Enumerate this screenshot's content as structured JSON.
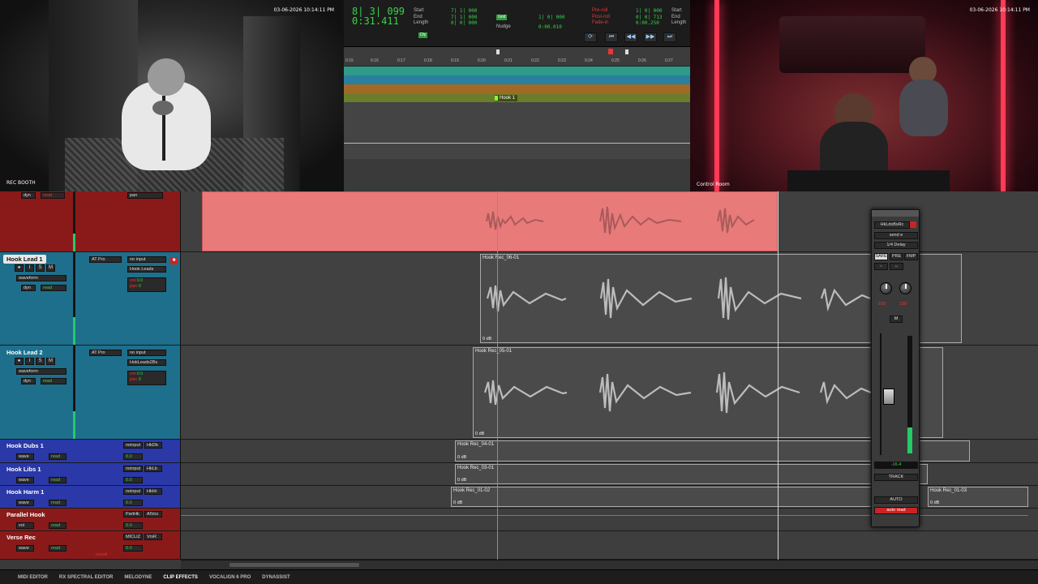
{
  "colors": {
    "accent_green": "#3bd14a",
    "clip_red": "#e87a7a",
    "track_blue": "#1e7c9c",
    "track_purple": "#2a38a8",
    "track_red": "#8a1a1a"
  },
  "cameras": {
    "booth": {
      "timestamp": "03-06-2026 10:14:11 PM",
      "label": "REC BOOTH"
    },
    "control": {
      "timestamp": "03-06-2026 10:14:11 PM",
      "label": "Control Room"
    }
  },
  "transport": {
    "main_counter": "8| 3| 099",
    "sub_counter": "0:31.411",
    "start_label": "Start",
    "end_label": "End",
    "length_label": "Length",
    "start_val": "7| 1| 000",
    "end_val": "7| 1| 000",
    "length_val": "0| 0| 000",
    "grid_label": "Grid",
    "grid_val": "1| 0| 000",
    "nudge_label": "Nudge",
    "nudge_val": "0:00.010",
    "dly_label": "Dly",
    "preroll_label": "Pre-roll",
    "postroll_label": "Post-roll",
    "fadein_label": "Fade-in",
    "preroll_val": "1| 0| 000",
    "postroll_val": "0| 0| 713",
    "fadein_val": "0:00.250",
    "start2_label": "Start",
    "end2_label": "End",
    "length2_label": "Length"
  },
  "ruler": {
    "ticks": [
      "0:15",
      "0:16",
      "0:17",
      "0:18",
      "0:19",
      "0:20",
      "0:21",
      "0:22",
      "0:23",
      "0:24",
      "0:25",
      "0:26",
      "0:27"
    ],
    "marker_label": "Hook 1"
  },
  "tracks": [
    {
      "name": "",
      "pan_label": "pan",
      "dyn_label": "dyn",
      "read_label": "read"
    },
    {
      "name": "Hook Lead 1",
      "insert": "AT Pro",
      "input": "no input",
      "output": "Hook Leads",
      "view": "waveform",
      "dyn": "dyn",
      "read": "read",
      "vol_label": "vol",
      "vol": "0.0",
      "pan_label": "pan",
      "pan": "0"
    },
    {
      "name": "Hook Lead 2",
      "insert": "AT Pro",
      "input": "no input",
      "output": "HokLeads2Bs",
      "view": "waveform",
      "dyn": "dyn",
      "read": "read",
      "vol_label": "vol",
      "vol": "0.0",
      "pan_label": "pan",
      "pan": "0"
    },
    {
      "name": "Hook Dubs 1",
      "io1": "noinput",
      "io2": "HkDb",
      "view": "wave",
      "read": "read",
      "vol": "0.0",
      "p1": "P",
      "p2": "P"
    },
    {
      "name": "Hook Libs 1",
      "io1": "noinput",
      "io2": "HkLb",
      "view": "wave",
      "read": "read",
      "vol": "0.0",
      "p1": "P",
      "p2": "P"
    },
    {
      "name": "Hook Harm 1",
      "io1": "noinput",
      "io2": "HkHr",
      "view": "wave",
      "read": "read",
      "vol": "0.0",
      "p1": "P",
      "p2": "P"
    },
    {
      "name": "Parallel Hook",
      "io1": "PartHk",
      "io2": "AlVox",
      "view": "vol",
      "read": "read",
      "vol": "0.0",
      "p1": "P",
      "p2": "P"
    },
    {
      "name": "Verse Rec",
      "io1": "MICLIZ",
      "io2": "VrsR",
      "view": "wave",
      "read": "read",
      "vol": "0.0",
      "p1": "P",
      "p2": "P"
    }
  ],
  "clips": [
    {
      "name": "Hook Rec_06-01",
      "gain": "0 dB"
    },
    {
      "name": "Hook Rec_05-01",
      "gain": "0 dB"
    },
    {
      "name": "Hook Rec_04-01",
      "gain": "0 dB"
    },
    {
      "name": "Hook Rec_03-01",
      "gain": "0 dB"
    },
    {
      "name": "Hook Rec_01-02",
      "gain": "0 dB"
    },
    {
      "name": "Hook Rec_01-03",
      "gain": "0 dB"
    }
  ],
  "send_window": {
    "title": "HkLdsBsRc",
    "send": "send e",
    "insert": "1/4 Delay",
    "safe": "SAFE",
    "pre": "PRE",
    "fmp": "FMP",
    "pan_l": "-100",
    "pan_r": "100",
    "mute": "M",
    "level": "-16.4",
    "track_btn": "TRACK",
    "auto_btn": "AUTO",
    "auto_mode": "auto read"
  },
  "bottom_tabs": [
    "MIDI EDITOR",
    "RX SPECTRAL EDITOR",
    "MELODYNE",
    "CLIP EFFECTS",
    "VOCALIGN 6 PRO",
    "DYNASSIST"
  ],
  "active_tab": "CLIP EFFECTS",
  "record_label": "record"
}
